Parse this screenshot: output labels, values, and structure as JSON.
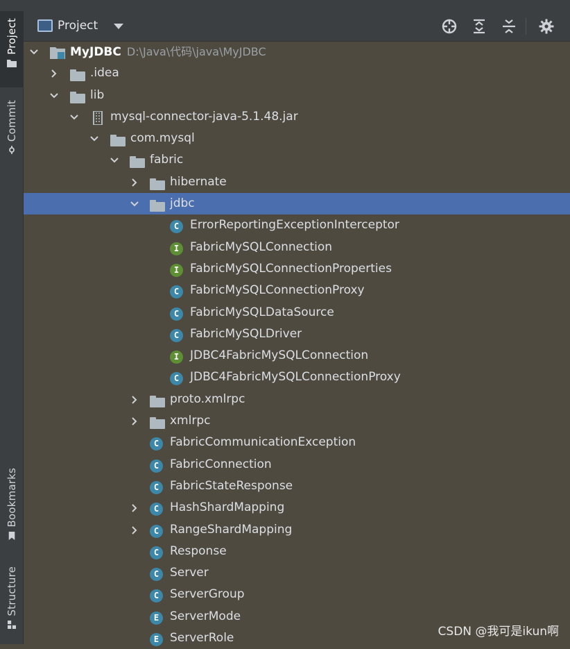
{
  "window": {
    "breadcrumb_fragment": ""
  },
  "side_tabs": {
    "project": "Project",
    "commit": "Commit",
    "bookmarks": "Bookmarks",
    "structure": "Structure"
  },
  "header": {
    "title": "Project",
    "icons": [
      "select-opened-file-icon",
      "expand-all-icon",
      "collapse-all-icon",
      "gear-icon"
    ]
  },
  "tree": {
    "root": {
      "name": "MyJDBC",
      "path": "D:\\Java\\代码\\java\\MyJDBC"
    },
    "idea": ".idea",
    "lib": "lib",
    "jar": "mysql-connector-java-5.1.48.jar",
    "com_mysql": "com.mysql",
    "fabric": "fabric",
    "hibernate": "hibernate",
    "jdbc": "jdbc",
    "jdbc_children": [
      {
        "kind": "C",
        "name": "ErrorReportingExceptionInterceptor"
      },
      {
        "kind": "I",
        "name": "FabricMySQLConnection"
      },
      {
        "kind": "I",
        "name": "FabricMySQLConnectionProperties"
      },
      {
        "kind": "C",
        "name": "FabricMySQLConnectionProxy"
      },
      {
        "kind": "C",
        "name": "FabricMySQLDataSource"
      },
      {
        "kind": "C",
        "name": "FabricMySQLDriver"
      },
      {
        "kind": "I",
        "name": "JDBC4FabricMySQLConnection"
      },
      {
        "kind": "C",
        "name": "JDBC4FabricMySQLConnectionProxy"
      }
    ],
    "proto_xmlrpc": "proto.xmlrpc",
    "xmlrpc": "xmlrpc",
    "fabric_classes": [
      {
        "kind": "C",
        "name": "FabricCommunicationException",
        "expandable": false
      },
      {
        "kind": "C",
        "name": "FabricConnection",
        "expandable": false
      },
      {
        "kind": "C",
        "name": "FabricStateResponse",
        "expandable": false
      },
      {
        "kind": "C",
        "name": "HashShardMapping",
        "expandable": true
      },
      {
        "kind": "C",
        "name": "RangeShardMapping",
        "expandable": true
      },
      {
        "kind": "C",
        "name": "Response",
        "expandable": false
      },
      {
        "kind": "C",
        "name": "Server",
        "expandable": false
      },
      {
        "kind": "C",
        "name": "ServerGroup",
        "expandable": false
      },
      {
        "kind": "E",
        "name": "ServerMode",
        "expandable": false
      },
      {
        "kind": "E",
        "name": "ServerRole",
        "expandable": false
      }
    ]
  },
  "colors": {
    "tree_bg": "#4e4a3f",
    "selection": "#4b6eaf",
    "class_badge": "#3d87a8",
    "interface_badge": "#5f8f35"
  },
  "watermark": "CSDN @我可是ikun啊"
}
